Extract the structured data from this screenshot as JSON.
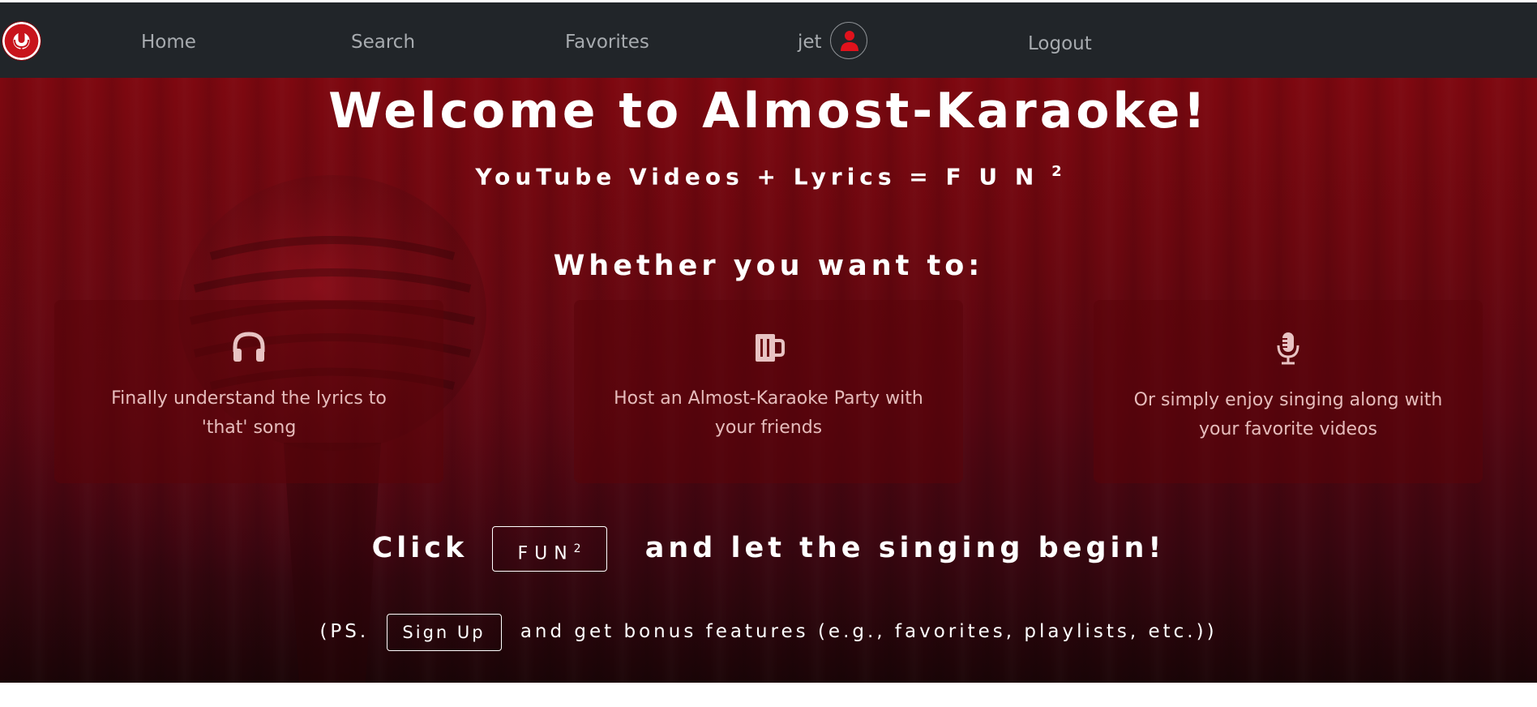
{
  "nav": {
    "logo_icon": "microphone-logo-icon",
    "items": [
      {
        "label": "Home"
      },
      {
        "label": "Search"
      },
      {
        "label": "Favorites"
      },
      {
        "label": "jet"
      },
      {
        "label": "Logout"
      }
    ],
    "user_icon": "user-icon"
  },
  "hero": {
    "title": "Welcome to Almost-Karaoke!",
    "subtitle_text": "YouTube Videos + Lyrics = F U N",
    "subtitle_sup": "2",
    "whether": "Whether you want to:"
  },
  "cards": [
    {
      "icon": "headphones-icon",
      "text": "Finally understand the lyrics to 'that' song"
    },
    {
      "icon": "beer-mug-icon",
      "text": "Host an Almost-Karaoke Party with your friends"
    },
    {
      "icon": "microphone-icon",
      "text": "Or simply enjoy singing along with your favorite videos"
    }
  ],
  "cta": {
    "prefix": "Click",
    "button_label": "FUN",
    "button_sup": "2",
    "suffix": "and let the singing begin!"
  },
  "ps": {
    "prefix": "(PS.",
    "button_label": "Sign Up",
    "suffix": "and get bonus features (e.g., favorites, playlists, etc.))"
  },
  "colors": {
    "navbar": "#212529",
    "accent_red": "#e0121c",
    "hero_top": "#7e0810",
    "hero_bottom": "#1b0507"
  }
}
